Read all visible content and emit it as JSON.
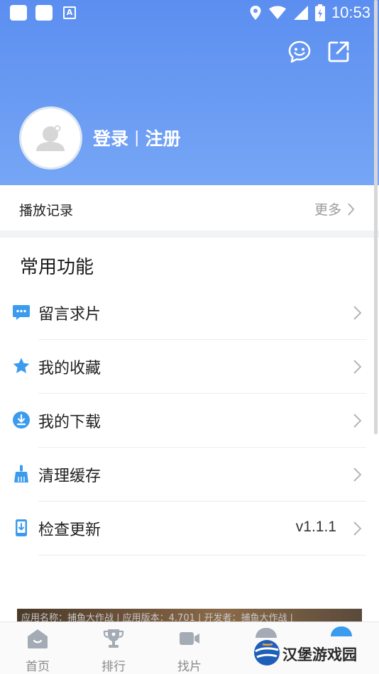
{
  "status_bar": {
    "time": "10:53",
    "badge_letter": "A"
  },
  "profile": {
    "login_label": "登录",
    "separator": "|",
    "register_label": "注册"
  },
  "history": {
    "label": "播放记录",
    "more_label": "更多"
  },
  "section": {
    "title": "常用功能"
  },
  "menu": [
    {
      "label": "留言求片",
      "icon": "message-icon",
      "value": ""
    },
    {
      "label": "我的收藏",
      "icon": "star-icon",
      "value": ""
    },
    {
      "label": "我的下载",
      "icon": "download-icon",
      "value": ""
    },
    {
      "label": "清理缓存",
      "icon": "broom-icon",
      "value": ""
    },
    {
      "label": "检查更新",
      "icon": "update-icon",
      "value": "v1.1.1"
    }
  ],
  "banner": {
    "text": "应用名称：捕鱼大作战 | 应用版本：4.701 | 开发者：捕鱼大作战 |"
  },
  "tabs": [
    {
      "label": "首页",
      "icon": "home-icon"
    },
    {
      "label": "排行",
      "icon": "trophy-icon"
    },
    {
      "label": "找片",
      "icon": "video-camera-icon"
    }
  ],
  "watermark": {
    "text": "汉堡游戏园"
  },
  "colors": {
    "hero_blue": "#5b8ef0",
    "accent_blue": "#3b9bef",
    "text_gray": "#9a9a9a"
  }
}
